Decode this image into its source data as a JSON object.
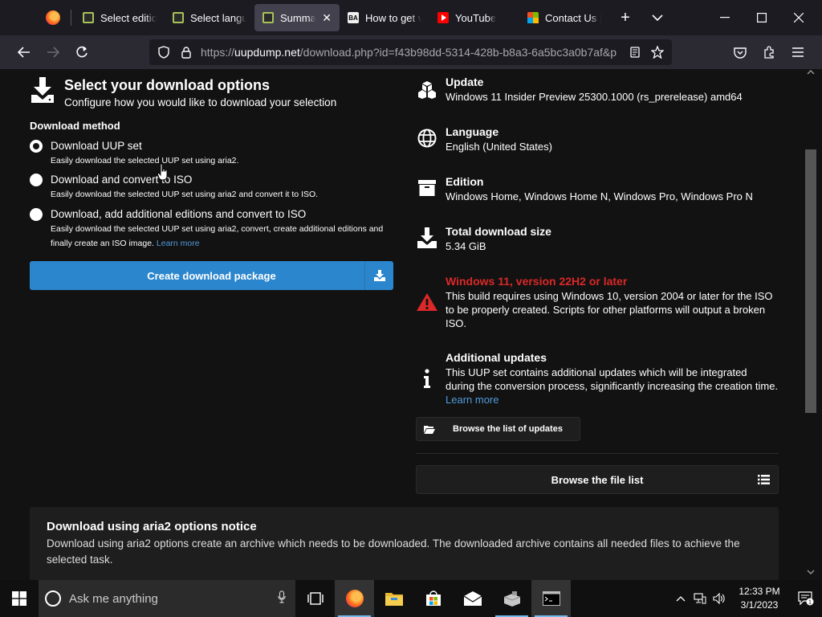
{
  "browser": {
    "tabs": [
      {
        "label": "Select edition",
        "icon": "uup-favicon"
      },
      {
        "label": "Select language",
        "icon": "uup-favicon"
      },
      {
        "label": "Summary",
        "icon": "uup-favicon",
        "active": true
      },
      {
        "label": "How to get v",
        "icon": "ba-favicon"
      },
      {
        "label": "YouTube",
        "icon": "youtube-favicon"
      },
      {
        "label": "Contact Us |",
        "icon": "microsoft-favicon"
      }
    ],
    "new_tab_symbol": "+",
    "list_tabs_symbol": "⌄",
    "url_prefix": "https://",
    "url_domain": "uupdump.net",
    "url_path": "/download.php?id=f43b98dd-5314-428b-b8a3-6a5bc3a0b7af&p"
  },
  "page": {
    "heading": "Select your download options",
    "subheading": "Configure how you would like to download your selection",
    "method_label": "Download method",
    "options": [
      {
        "title": "Download UUP set",
        "desc": "Easily download the selected UUP set using aria2.",
        "checked": true
      },
      {
        "title": "Download and convert to ISO",
        "desc": "Easily download the selected UUP set using aria2 and convert it to ISO.",
        "checked": false
      },
      {
        "title": "Download, add additional editions and convert to ISO",
        "desc": "Easily download the selected UUP set using aria2, convert, create additional editions and finally create an ISO image.",
        "link": "Learn more",
        "checked": false
      }
    ],
    "create_button": "Create download package",
    "info": {
      "update_title": "Update",
      "update_value": "Windows 11 Insider Preview 25300.1000 (rs_prerelease) amd64",
      "language_title": "Language",
      "language_value": "English (United States)",
      "edition_title": "Edition",
      "edition_value": "Windows Home, Windows Home N, Windows Pro, Windows Pro N",
      "size_title": "Total download size",
      "size_value": "5.34 GiB",
      "warning_title": "Windows 11, version 22H2 or later",
      "warning_text": "This build requires using Windows 10, version 2004 or later for the ISO to be properly created. Scripts for other platforms will output a broken ISO.",
      "additional_title": "Additional updates",
      "additional_text": "This UUP set contains additional updates which will be integrated during the conversion process, significantly increasing the creation time.",
      "additional_link": "Learn more"
    },
    "browse_updates": "Browse the list of updates",
    "browse_files": "Browse the file list",
    "notice_title": "Download using aria2 options notice",
    "notice_text": "Download using aria2 options create an archive which needs to be downloaded. The downloaded archive contains all needed files to achieve the selected task."
  },
  "taskbar": {
    "search_placeholder": "Ask me anything",
    "time": "12:33 PM",
    "date": "3/1/2023",
    "notification_count": "1"
  },
  "colors": {
    "accent_blue": "#2b86cd",
    "warning_red": "#db2828",
    "link_blue": "#4f9bdb"
  }
}
